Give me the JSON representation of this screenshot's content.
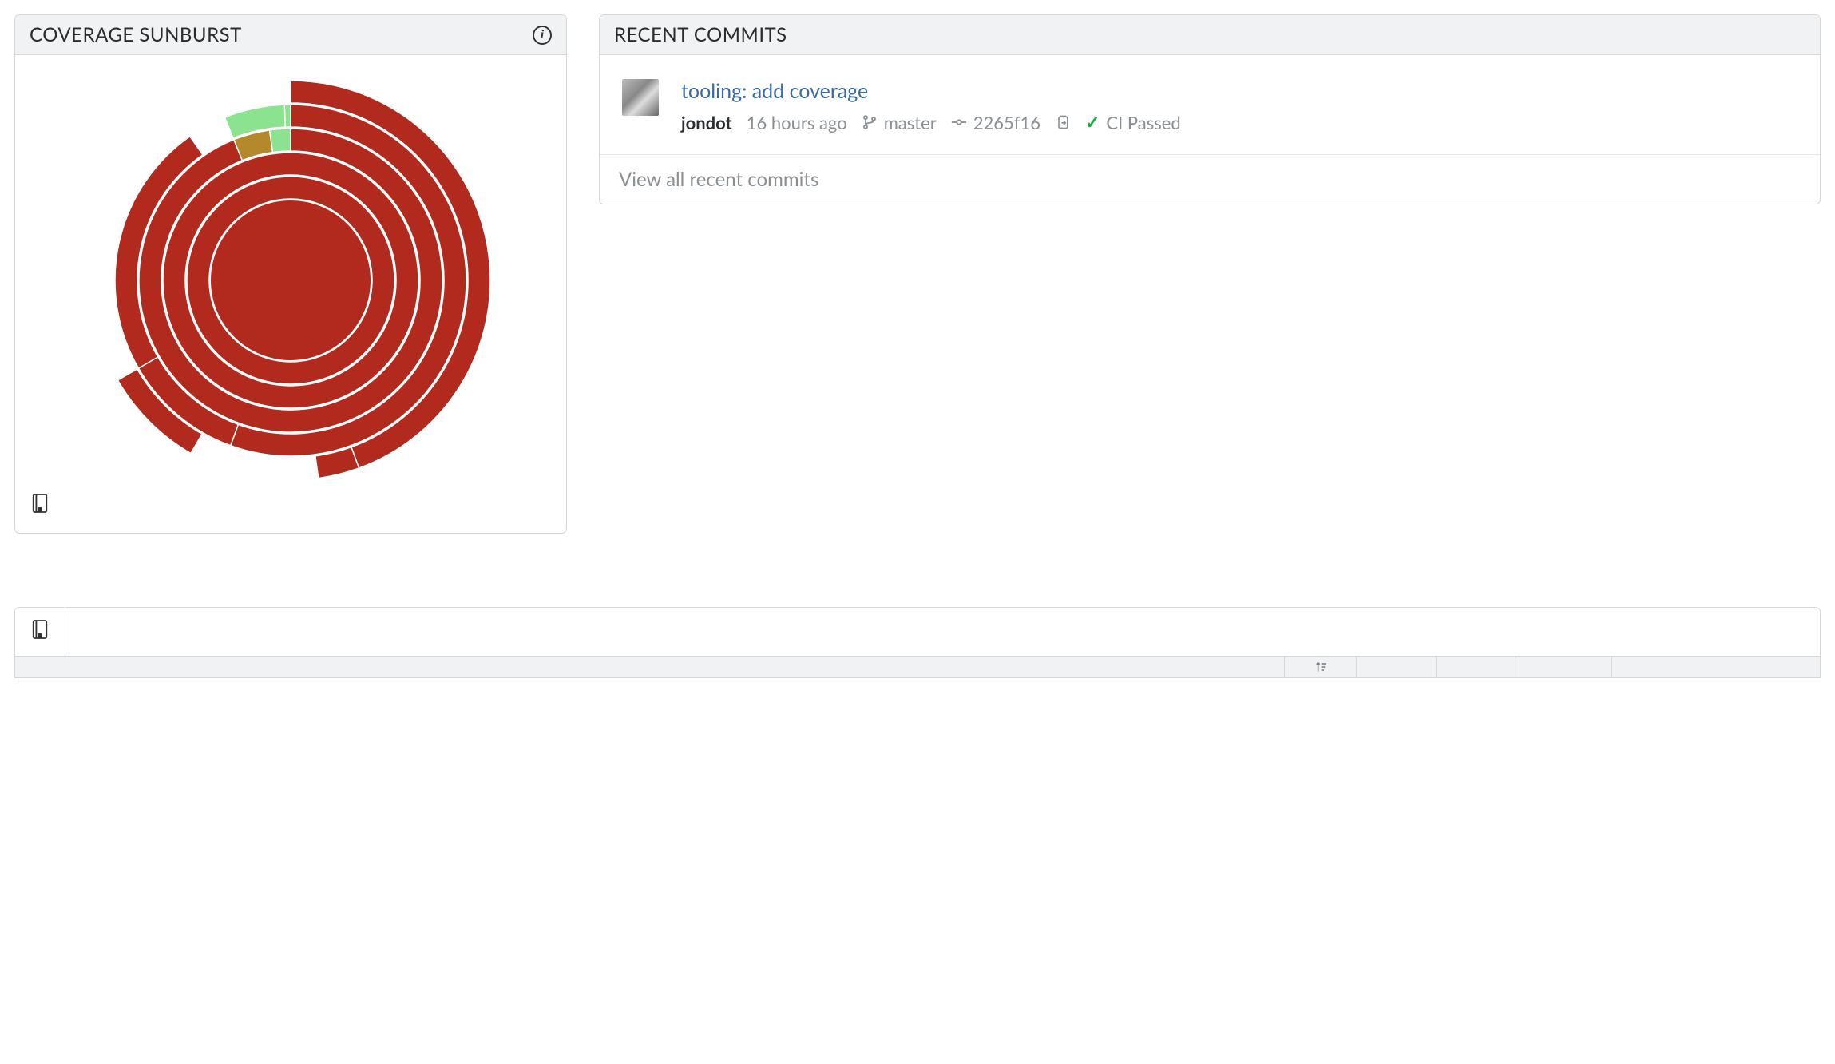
{
  "sunburst": {
    "title": "COVERAGE SUNBURST",
    "colors": {
      "low": "#b22a1e",
      "mid": "#b4892b",
      "high": "#8be28f"
    }
  },
  "commits": {
    "title": "RECENT COMMITS",
    "items": [
      {
        "message": "tooling: add coverage",
        "author": "jondot",
        "age": "16 hours ago",
        "branch": "master",
        "sha": "2265f16",
        "ci_status": "CI Passed"
      }
    ],
    "view_all": "View all recent commits"
  },
  "chart_data": {
    "type": "sunburst",
    "title": "Coverage Sunburst",
    "note": "Concentric rings show nested directory/file coverage. Color = coverage level (red=low, olive=mid, green=high). Arc span = relative size. Values are approximate degrees of span at each ring and coverage category inferred from color.",
    "center": {
      "coverage_bucket": "low"
    },
    "rings": [
      {
        "level": 1,
        "arcs": [
          {
            "start_deg": 0,
            "span_deg": 360,
            "coverage_bucket": "low"
          }
        ]
      },
      {
        "level": 2,
        "arcs": [
          {
            "start_deg": 0,
            "span_deg": 360,
            "coverage_bucket": "low"
          }
        ]
      },
      {
        "level": 3,
        "arcs": [
          {
            "start_deg": 0,
            "span_deg": 338,
            "coverage_bucket": "low"
          },
          {
            "start_deg": 338,
            "span_deg": 14,
            "coverage_bucket": "mid"
          },
          {
            "start_deg": 352,
            "span_deg": 8,
            "coverage_bucket": "high"
          }
        ]
      },
      {
        "level": 4,
        "arcs": [
          {
            "start_deg": 0,
            "span_deg": 200,
            "coverage_bucket": "low"
          },
          {
            "start_deg": 200,
            "span_deg": 40,
            "coverage_bucket": "low"
          },
          {
            "start_deg": 240,
            "span_deg": 85,
            "coverage_bucket": "low"
          },
          {
            "start_deg": 338,
            "span_deg": 20,
            "coverage_bucket": "high"
          },
          {
            "start_deg": 358,
            "span_deg": 2,
            "coverage_bucket": "high"
          }
        ]
      },
      {
        "level": 5,
        "arcs": [
          {
            "start_deg": 0,
            "span_deg": 160,
            "coverage_bucket": "low"
          },
          {
            "start_deg": 160,
            "span_deg": 12,
            "coverage_bucket": "low"
          },
          {
            "start_deg": 210,
            "span_deg": 30,
            "coverage_bucket": "low"
          }
        ]
      }
    ]
  }
}
